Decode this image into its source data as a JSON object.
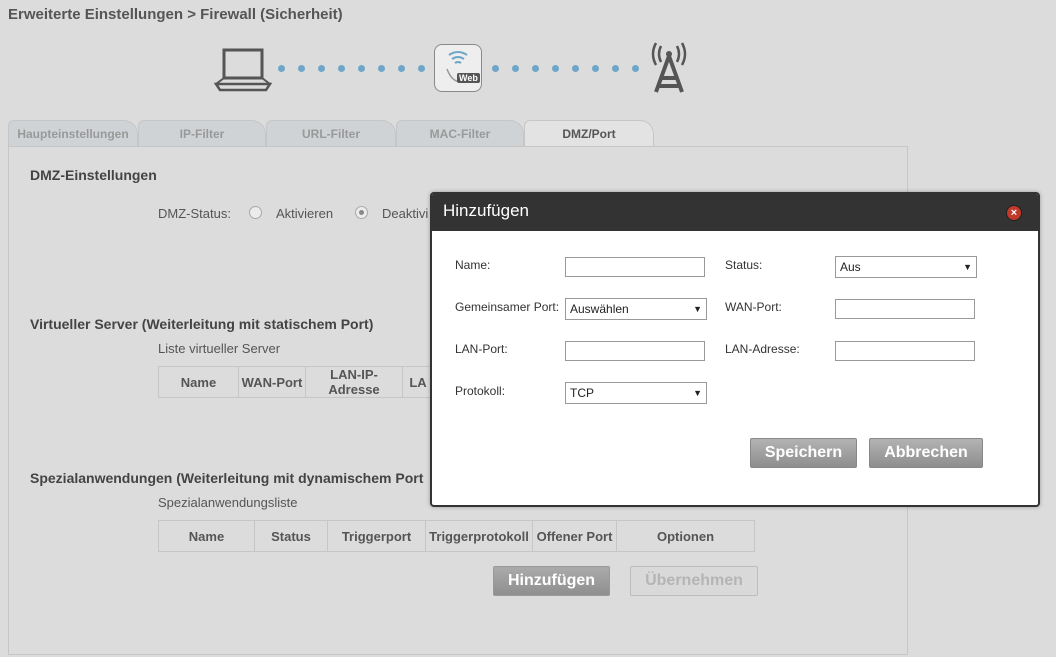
{
  "page_title": "Erweiterte Einstellungen > Firewall (Sicherheit)",
  "diagram": {
    "web_label": "Web",
    "laptop_icon": "laptop-icon",
    "web_icon": "web-globe-icon",
    "tower_icon": "antenna-tower-icon"
  },
  "tabs": [
    {
      "label": "Haupteinstellungen",
      "active": false
    },
    {
      "label": "IP-Filter",
      "active": false
    },
    {
      "label": "URL-Filter",
      "active": false
    },
    {
      "label": "MAC-Filter",
      "active": false
    },
    {
      "label": "DMZ/Port",
      "active": true
    }
  ],
  "dmz": {
    "heading": "DMZ-Einstellungen",
    "status_label": "DMZ-Status:",
    "option_activate": "Aktivieren",
    "option_deactivate": "Deaktivi",
    "selected": "deactivate"
  },
  "virtual_server": {
    "heading": "Virtueller Server (Weiterleitung mit statischem Port)",
    "list_label": "Liste virtueller Server",
    "columns": [
      "Name",
      "WAN-Port",
      "LAN-IP-Adresse",
      "LA"
    ]
  },
  "special_apps": {
    "heading": "Spezialanwendungen (Weiterleitung mit dynamischem Port",
    "list_label": "Spezialanwendungsliste",
    "columns": [
      "Name",
      "Status",
      "Triggerport",
      "Triggerprotokoll",
      "Offener Port",
      "Optionen"
    ],
    "add_button": "Hinzufügen",
    "apply_button": "Übernehmen"
  },
  "modal": {
    "title": "Hinzufügen",
    "fields": {
      "name_label": "Name:",
      "name_value": "",
      "status_label": "Status:",
      "status_value": "Aus",
      "common_port_label": "Gemeinsamer Port:",
      "common_port_value": "Auswählen",
      "wan_port_label": "WAN-Port:",
      "wan_port_value": "",
      "lan_port_label": "LAN-Port:",
      "lan_port_value": "",
      "lan_address_label": "LAN-Adresse:",
      "lan_address_value": "",
      "protocol_label": "Protokoll:",
      "protocol_value": "TCP"
    },
    "save_button": "Speichern",
    "cancel_button": "Abbrechen"
  },
  "colors": {
    "background": "#dcdcdc",
    "dots": "#6ea6c9",
    "modal_header": "#333333",
    "close": "#c0392b"
  }
}
